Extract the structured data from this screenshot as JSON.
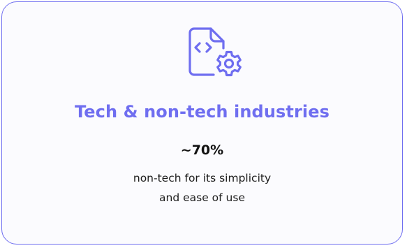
{
  "card": {
    "accent_color": "#6f6ef0",
    "icon": "code-file-gear-icon",
    "title": "Tech & non-tech industries",
    "stat": "~70%",
    "description_lines": [
      "non-tech for its simplicity",
      "and ease of use"
    ]
  }
}
